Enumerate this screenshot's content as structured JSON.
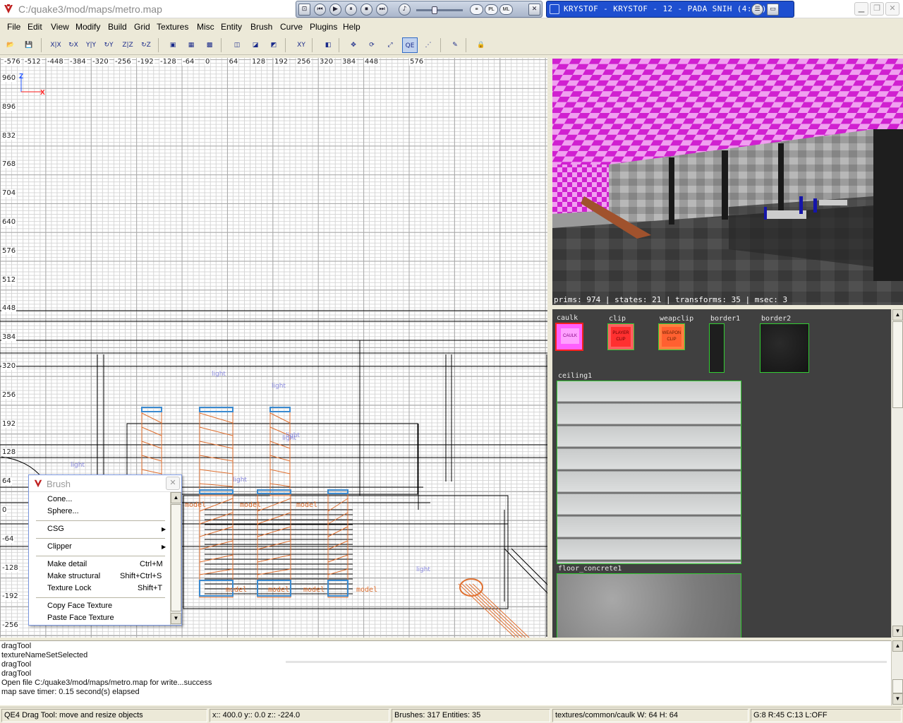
{
  "window": {
    "title": "C:/quake3/mod/maps/metro.map",
    "minimize_icon": "minimize-icon",
    "maximize_icon": "maximize-icon",
    "close_icon": "close-icon"
  },
  "media_player": {
    "buttons": [
      "prev-icon",
      "play-icon",
      "pause-icon",
      "stop-icon",
      "next-icon",
      "volume-icon"
    ],
    "volume_percent": 40,
    "pills": [
      "PL",
      "ML"
    ],
    "now_playing": "KRYSTOF - KRYSTOF - 12 - PADA SNIH (4:36)"
  },
  "menu": {
    "items": [
      "File",
      "Edit",
      "View",
      "Modify",
      "Build",
      "Grid",
      "Textures",
      "Misc",
      "Entity",
      "Brush",
      "Curve",
      "Plugins",
      "Help"
    ]
  },
  "toolbar": {
    "buttons": [
      {
        "icon": "open-icon",
        "glyph": "📂"
      },
      {
        "icon": "save-icon",
        "glyph": "💾"
      },
      {
        "icon": "flip-x-icon",
        "glyph": "X|X"
      },
      {
        "icon": "rotate-x-icon",
        "glyph": "↻X"
      },
      {
        "icon": "flip-y-icon",
        "glyph": "Y|Y"
      },
      {
        "icon": "rotate-y-icon",
        "glyph": "↻Y"
      },
      {
        "icon": "flip-z-icon",
        "glyph": "Z|Z"
      },
      {
        "icon": "rotate-z-icon",
        "glyph": "↻Z"
      },
      {
        "icon": "select-complete-icon",
        "glyph": "▣"
      },
      {
        "icon": "select-inside-icon",
        "glyph": "▦"
      },
      {
        "icon": "select-touching-icon",
        "glyph": "▩"
      },
      {
        "icon": "csg-hollow-icon",
        "glyph": "◫"
      },
      {
        "icon": "csg-subtract-icon",
        "glyph": "◪"
      },
      {
        "icon": "csg-merge-icon",
        "glyph": "◩"
      },
      {
        "icon": "change-view-icon",
        "glyph": "XY"
      },
      {
        "icon": "texture-view-icon",
        "glyph": "◧"
      },
      {
        "icon": "translate-icon",
        "glyph": "✥"
      },
      {
        "icon": "rotate-icon",
        "glyph": "⟳"
      },
      {
        "icon": "scale-icon",
        "glyph": "⤢"
      },
      {
        "icon": "qe-drag-icon",
        "glyph": "QE",
        "active": true
      },
      {
        "icon": "vertex-edit-icon",
        "glyph": "⋰"
      },
      {
        "icon": "patch-icon",
        "glyph": "✎"
      },
      {
        "icon": "lock-icon",
        "glyph": "🔒"
      }
    ]
  },
  "view2d": {
    "h_ticks": [
      "-576",
      "-512",
      "-448",
      "-384",
      "-320",
      "-256",
      "-192",
      "-128",
      "-64",
      "0",
      "64",
      "128",
      "192",
      "256",
      "320",
      "384",
      "448",
      "576"
    ],
    "v_ticks": [
      "960",
      "896",
      "832",
      "768",
      "704",
      "640",
      "576",
      "512",
      "448",
      "384",
      "320",
      "256",
      "192",
      "128",
      "64",
      "0",
      "-64",
      "-128",
      "-192",
      "-256"
    ],
    "axis_vertical": "Z",
    "axis_horizontal": "X",
    "entity_labels": [
      "light",
      "light",
      "light",
      "light",
      "light",
      "light",
      "light"
    ],
    "model_labels": [
      "model",
      "model",
      "model",
      "model",
      "model",
      "model",
      "model"
    ]
  },
  "camera": {
    "stats": "prims: 974 | states: 21 | transforms: 35 | msec: 3",
    "ceiling_color": "#d020d0",
    "floor_color": "#3a3a3a"
  },
  "textures": {
    "items": [
      {
        "name": "caulk",
        "label": "CAULK",
        "selected": true
      },
      {
        "name": "clip",
        "label": "PLAYER CLIP"
      },
      {
        "name": "weapclip",
        "label": "WEAPON CLIP"
      },
      {
        "name": "border1"
      },
      {
        "name": "border2"
      },
      {
        "name": "ceiling1"
      },
      {
        "name": "floor_concrete1"
      }
    ]
  },
  "console": {
    "lines": [
      "dragTool",
      "textureNameSetSelected",
      "dragTool",
      "dragTool",
      "Open file C:/quake3/mod/maps/metro.map for write...success",
      "map save timer:  0.15 second(s) elapsed"
    ]
  },
  "status": {
    "tool": "QE4 Drag Tool: move and resize objects",
    "coords": "x::  400.0  y::    0.0  z::  -224.0",
    "counts": "Brushes: 317 Entities: 35",
    "texture": "textures/common/caulk W: 64 H: 64",
    "grid": "G:8  R:45  C:13  L:OFF"
  },
  "brush_menu": {
    "title": "Brush",
    "items": [
      {
        "label": "Cone..."
      },
      {
        "label": "Sphere..."
      },
      {
        "label": "CSG",
        "submenu": true
      },
      {
        "label": "Clipper",
        "submenu": true
      },
      {
        "label": "Make detail",
        "shortcut": "Ctrl+M"
      },
      {
        "label": "Make structural",
        "shortcut": "Shift+Ctrl+S"
      },
      {
        "label": "Texture Lock",
        "shortcut": "Shift+T"
      },
      {
        "label": "Copy Face Texture"
      },
      {
        "label": "Paste Face Texture"
      }
    ]
  }
}
